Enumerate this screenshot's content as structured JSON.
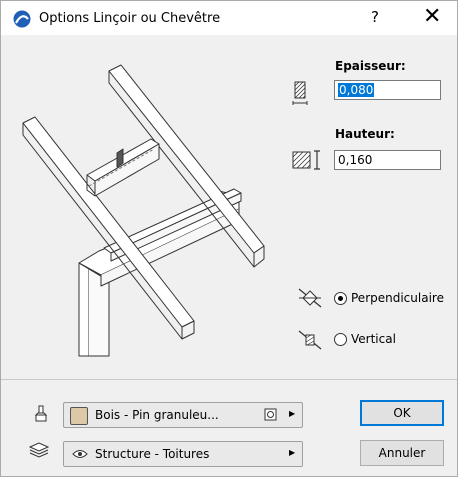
{
  "window": {
    "title": "Options Linçoir ou Chevêtre",
    "help_label": "?",
    "close_label": "✕"
  },
  "thickness": {
    "label": "Epaisseur:",
    "value": "0,080"
  },
  "height": {
    "label": "Hauteur:",
    "value": "0,160"
  },
  "orientation": {
    "options": [
      {
        "label": "Perpendiculaire",
        "selected": true
      },
      {
        "label": "Vertical",
        "selected": false
      }
    ]
  },
  "material": {
    "label": "Bois - Pin granuleu...",
    "swatch_color": "#dcc9a8"
  },
  "layer": {
    "label": "Structure - Toitures"
  },
  "buttons": {
    "ok": "OK",
    "cancel": "Annuler"
  },
  "colors": {
    "accent": "#0078d7",
    "selection": "#0078d7"
  }
}
